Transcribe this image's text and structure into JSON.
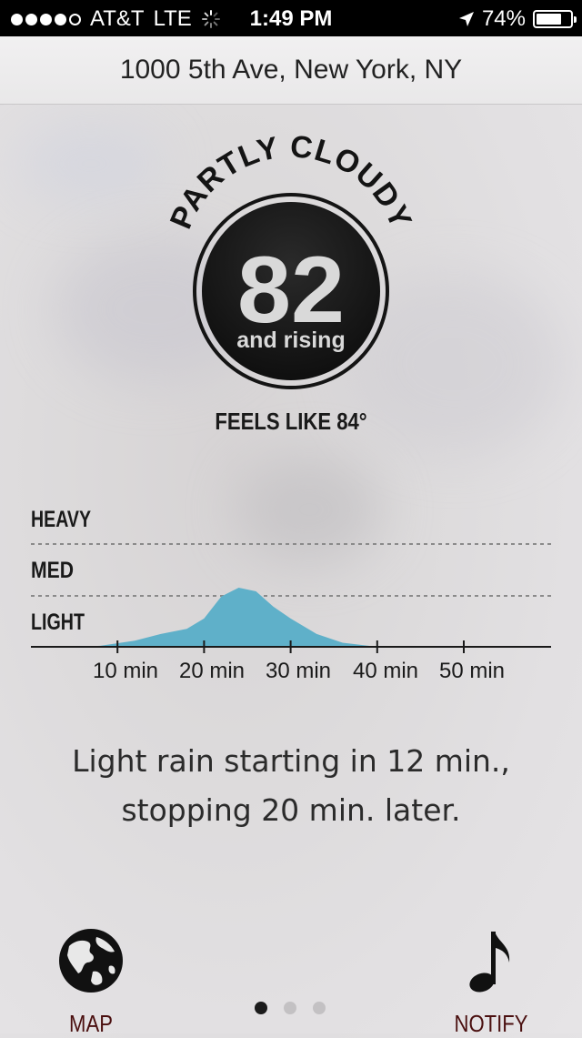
{
  "status_bar": {
    "carrier": "AT&T",
    "network": "LTE",
    "time": "1:49 PM",
    "battery": "74%",
    "battery_level": 0.74,
    "signal_bars": 4,
    "icons": [
      "signal-dots-icon",
      "activity-spinner-icon",
      "location-arrow-icon",
      "battery-icon"
    ]
  },
  "header": {
    "location": "1000 5th Ave, New York, NY"
  },
  "current": {
    "condition": "PARTLY CLOUDY",
    "temperature": "82",
    "trend": "and rising",
    "feels_like": "FEELS LIKE 84°"
  },
  "precip_chart": {
    "levels": [
      "HEAVY",
      "MED",
      "LIGHT"
    ],
    "ticks": [
      "10 min",
      "20 min",
      "30 min",
      "40 min",
      "50 min"
    ]
  },
  "chart_data": {
    "type": "area",
    "title": "",
    "xlabel": "",
    "ylabel": "",
    "x": [
      0,
      5,
      8,
      12,
      15,
      18,
      20,
      22,
      24,
      26,
      28,
      30,
      33,
      36,
      40,
      45,
      50,
      55,
      60
    ],
    "series": [
      {
        "values": [
          0,
          0,
          0.02,
          0.12,
          0.25,
          0.35,
          0.55,
          0.98,
          1.15,
          1.08,
          0.78,
          0.55,
          0.25,
          0.08,
          0,
          0,
          0,
          0,
          0
        ]
      }
    ],
    "y_categories": [
      "LIGHT",
      "MED",
      "HEAVY"
    ],
    "ylim": [
      0,
      2.5
    ],
    "xlim": [
      0,
      60
    ],
    "x_ticks": [
      10,
      20,
      30,
      40,
      50
    ],
    "grid": true,
    "color": "#5fb0c9"
  },
  "summary": {
    "line1": "Light rain starting in 12 min.,",
    "line2": "stopping 20 min. later."
  },
  "nav": {
    "map_label": "MAP",
    "notify_label": "NOTIFY",
    "pages": 3,
    "active_page": 0
  },
  "colors": {
    "badge": "#141414",
    "rain": "#5fb0c9",
    "nav_label": "#4a0f0f"
  }
}
